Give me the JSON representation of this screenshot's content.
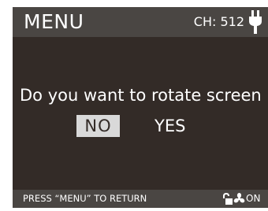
{
  "header": {
    "title": "MENU",
    "channel": "CH: 512",
    "power_icon": "plug-icon"
  },
  "dialog": {
    "question": "Do you want to rotate screen",
    "no_label": "NO",
    "yes_label": "YES",
    "selected": "NO"
  },
  "footer": {
    "hint": "PRESS “MENU” TO RETURN",
    "lock_icon": "unlocked-padlock-icon",
    "fan_icon": "fan-icon",
    "fan_state": "ON"
  },
  "colors": {
    "background": "#332b27",
    "bar": "#4a4643",
    "selected_button": "#d9d9d9",
    "text": "#ffffff"
  }
}
